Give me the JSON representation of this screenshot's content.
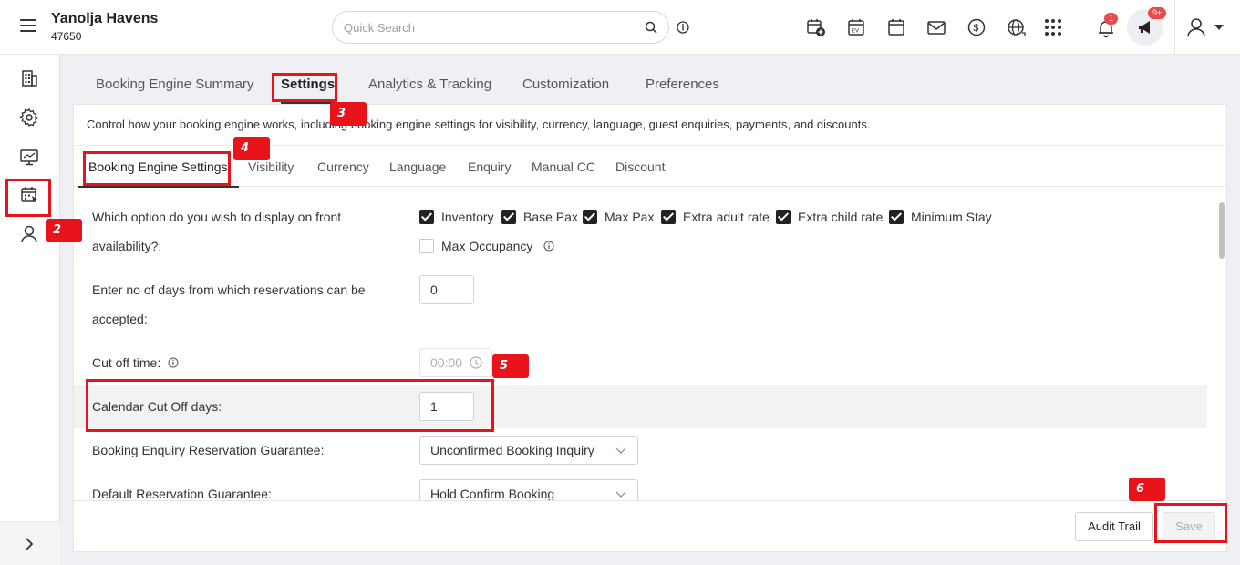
{
  "header": {
    "hotel_name": "Yanolja Havens",
    "hotel_id": "47650",
    "search_placeholder": "Quick Search",
    "notification_count": "1",
    "announcement_count": "9+"
  },
  "top_tabs": [
    {
      "label": "Booking Engine Summary"
    },
    {
      "label": "Settings"
    },
    {
      "label": "Analytics & Tracking"
    },
    {
      "label": "Customization"
    },
    {
      "label": "Preferences"
    }
  ],
  "description": "Control how your booking engine works, including booking engine settings for visibility, currency, language, guest enquiries, payments, and discounts.",
  "sub_tabs": [
    {
      "label": "Booking Engine Settings"
    },
    {
      "label": "Visibility"
    },
    {
      "label": "Currency"
    },
    {
      "label": "Language"
    },
    {
      "label": "Enquiry"
    },
    {
      "label": "Manual CC"
    },
    {
      "label": "Discount"
    }
  ],
  "form": {
    "display_option": {
      "label_line1": "Which option do you wish to display on front",
      "label_line2": "availability?:",
      "options": [
        {
          "label": "Inventory",
          "checked": true
        },
        {
          "label": "Base Pax",
          "checked": true
        },
        {
          "label": "Max Pax",
          "checked": true
        },
        {
          "label": "Extra adult rate",
          "checked": true
        },
        {
          "label": "Extra child rate",
          "checked": true
        },
        {
          "label": "Minimum Stay",
          "checked": true
        },
        {
          "label": "Max Occupancy",
          "checked": false
        }
      ]
    },
    "days_accept": {
      "label_line1": "Enter no of days from which reservations can be",
      "label_line2": "accepted:",
      "value": "0"
    },
    "cut_off_time": {
      "label": "Cut off time:",
      "value": "00:00"
    },
    "calendar_cut_off": {
      "label": "Calendar Cut Off days:",
      "value": "1"
    },
    "enquiry_guarantee": {
      "label": "Booking Enquiry Reservation Guarantee:",
      "value": "Unconfirmed Booking Inquiry"
    },
    "default_guarantee": {
      "label": "Default Reservation Guarantee:",
      "value": "Hold Confirm Booking"
    }
  },
  "footer": {
    "audit_label": "Audit Trail",
    "save_label": "Save"
  },
  "annotations": [
    "2",
    "3",
    "4",
    "5",
    "6"
  ],
  "colors": {
    "annotation": "#e8131b",
    "badge": "#e84a4a"
  }
}
